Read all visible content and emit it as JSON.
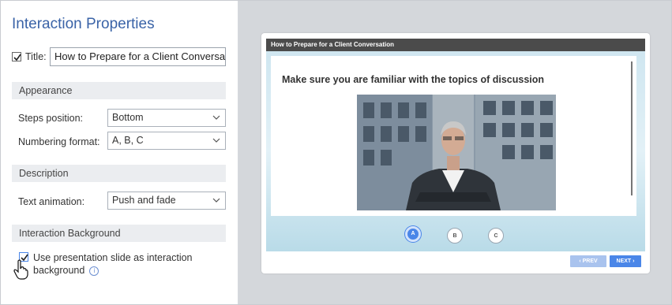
{
  "panel": {
    "title": "Interaction Properties",
    "title_label": "Title:",
    "title_value": "How to Prepare for a Client Conversation",
    "title_checked": true
  },
  "appearance": {
    "header": "Appearance",
    "steps_label": "Steps position:",
    "steps_value": "Bottom",
    "numbering_label": "Numbering format:",
    "numbering_value": "A, B, C"
  },
  "description": {
    "header": "Description",
    "text_anim_label": "Text animation:",
    "text_anim_value": "Push and fade"
  },
  "background": {
    "header": "Interaction Background",
    "use_slide_label": "Use presentation slide as interaction background",
    "use_slide_checked": true
  },
  "preview": {
    "header": "How to Prepare for a Client Conversation",
    "heading": "Make sure you are familiar with the topics of discussion",
    "steps": [
      "A",
      "B",
      "C"
    ],
    "active_step": "A",
    "prev_label": "‹ PREV",
    "next_label": "NEXT ›"
  },
  "colors": {
    "accent": "#3a63a7",
    "button_blue": "#4a86e8",
    "canvas_bg": "#d4d7db"
  }
}
